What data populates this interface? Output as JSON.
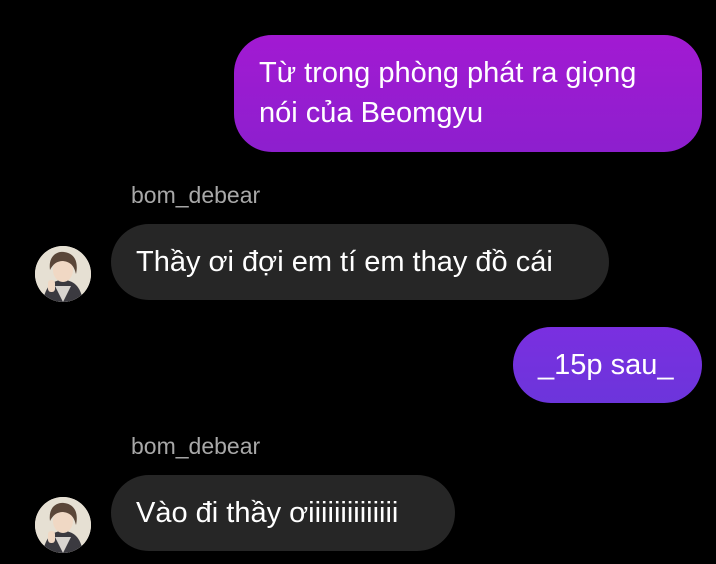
{
  "conversation": {
    "messages": [
      {
        "direction": "outgoing",
        "text": "Từ trong phòng phát ra giọng nói của Beomgyu"
      },
      {
        "direction": "incoming",
        "sender": "bom_debear",
        "text": "Thầy ơi đợi em tí em thay đồ cái"
      },
      {
        "direction": "outgoing",
        "text": "_15p sau_"
      },
      {
        "direction": "incoming",
        "sender": "bom_debear",
        "text": "Vào đi thầy ơiiiiiiiiiiiiii"
      }
    ]
  },
  "colors": {
    "background": "#000000",
    "outgoing_bubble_purple": "#9a1cd0",
    "outgoing_bubble_violet": "#7232de",
    "incoming_bubble": "#262626",
    "sender_text": "#a8a8a8"
  },
  "icons": {
    "avatar": "profile-photo-icon"
  }
}
